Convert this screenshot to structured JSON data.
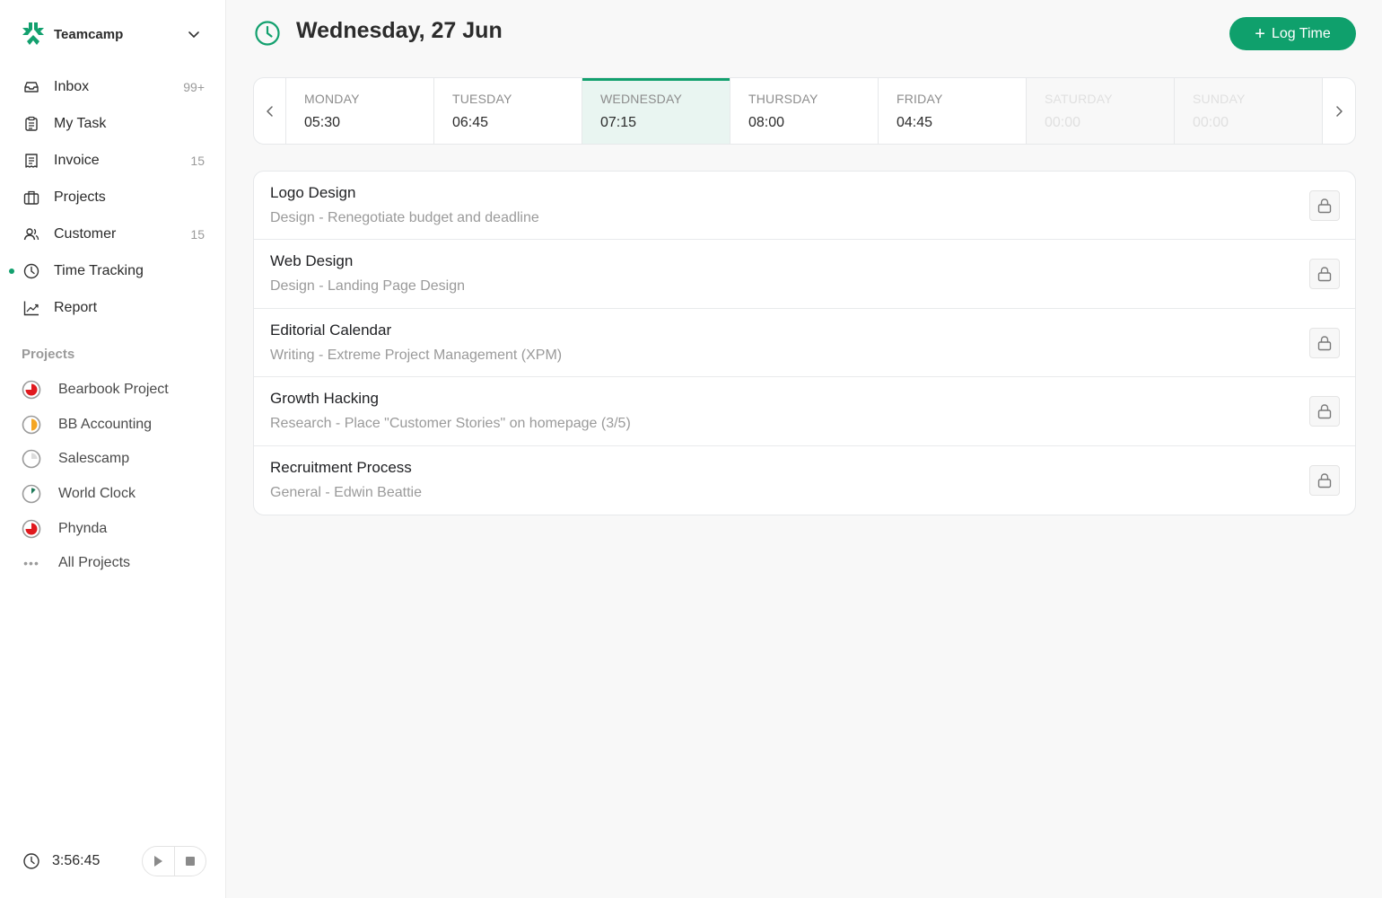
{
  "sidebar": {
    "brand": {
      "name": "Teamcamp",
      "color": "#12a06e"
    },
    "nav": [
      {
        "label": "Inbox",
        "icon": "inbox-icon",
        "count": "99+"
      },
      {
        "label": "My Task",
        "icon": "clipboard-icon",
        "count": ""
      },
      {
        "label": "Invoice",
        "icon": "receipt-icon",
        "count": "15"
      },
      {
        "label": "Projects",
        "icon": "briefcase-icon",
        "count": ""
      },
      {
        "label": "Customer",
        "icon": "users-icon",
        "count": "15"
      },
      {
        "label": "Time Tracking",
        "icon": "clock-icon",
        "count": "",
        "active": true
      },
      {
        "label": "Report",
        "icon": "chart-line-icon",
        "count": ""
      }
    ],
    "projects_title": "Projects",
    "projects": [
      {
        "label": "Bearbook Project",
        "progress": 0.75,
        "color": "#e0191e"
      },
      {
        "label": "BB Accounting",
        "progress": 0.5,
        "color": "#f5a623"
      },
      {
        "label": "Salescamp",
        "progress": 0.25,
        "color": "#dcdcdc"
      },
      {
        "label": "World Clock",
        "progress": 0.125,
        "color": "#1f7a5a"
      },
      {
        "label": "Phynda",
        "progress": 0.75,
        "color": "#e0191e"
      }
    ],
    "all_projects_label": "All Projects",
    "timer": {
      "value": "3:56:45"
    }
  },
  "header": {
    "title": "Wednesday, 27 Jun",
    "log_button": {
      "icon": "+",
      "label": "Log Time"
    },
    "accent": "#0fa06c"
  },
  "week": {
    "days": [
      {
        "name": "MONDAY",
        "time": "05:30",
        "state": "normal"
      },
      {
        "name": "TUESDAY",
        "time": "06:45",
        "state": "normal"
      },
      {
        "name": "WEDNESDAY",
        "time": "07:15",
        "state": "active"
      },
      {
        "name": "THURSDAY",
        "time": "08:00",
        "state": "normal"
      },
      {
        "name": "FRIDAY",
        "time": "04:45",
        "state": "normal"
      },
      {
        "name": "SATURDAY",
        "time": "00:00",
        "state": "weekend"
      },
      {
        "name": "SUNDAY",
        "time": "00:00",
        "state": "weekend"
      }
    ]
  },
  "tasks": [
    {
      "title": "Logo Design",
      "subtitle": "Design - Renegotiate budget and deadline"
    },
    {
      "title": "Web Design",
      "subtitle": "Design - Landing Page Design"
    },
    {
      "title": "Editorial Calendar",
      "subtitle": "Writing - Extreme Project Management (XPM)"
    },
    {
      "title": "Growth Hacking",
      "subtitle": "Research - Place \"Customer Stories\" on homepage (3/5)"
    },
    {
      "title": "Recruitment Process",
      "subtitle": "General - Edwin Beattie"
    }
  ]
}
